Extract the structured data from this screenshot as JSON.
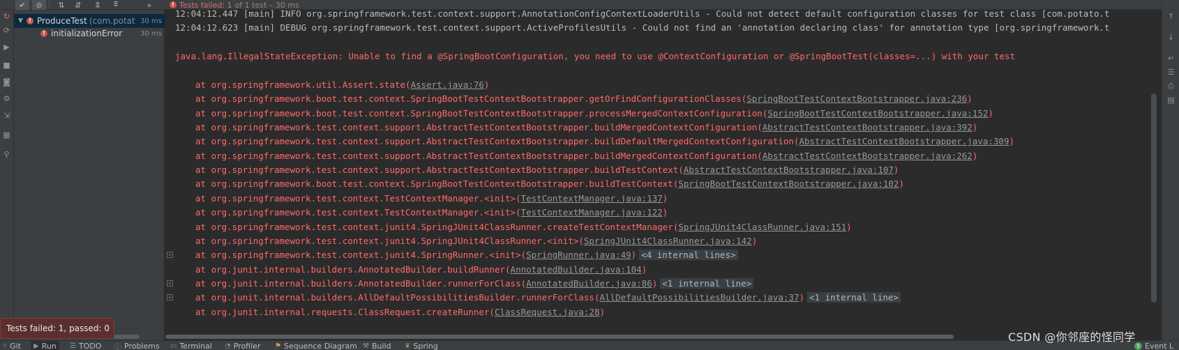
{
  "toolbar": {
    "show_passed_icon": "check-icon",
    "show_ignored_icon": "no-entry-icon",
    "sort_alpha_icon": "sort-alpha-icon",
    "sort_duration_icon": "sort-duration-icon",
    "expand_all_icon": "expand-all-icon",
    "collapse_all_icon": "collapse-all-icon",
    "more_icon": "double-chevron-icon"
  },
  "status": {
    "failed_text": "Tests failed: 1",
    "detail_text": "of 1 test – 30 ms"
  },
  "tree": {
    "root": {
      "name": "ProduceTest",
      "package": "(com.potat",
      "time": "30 ms"
    },
    "child": {
      "name": "initializationError",
      "time": "30 ms"
    }
  },
  "console": {
    "info_lines": [
      "12:04:12.447 [main] INFO org.springframework.test.context.support.AnnotationConfigContextLoaderUtils - Could not detect default configuration classes for test class [com.potato.t",
      "12:04:12.623 [main] DEBUG org.springframework.test.context.support.ActiveProfilesUtils - Could not find an 'annotation declaring class' for annotation type [org.springframework.t"
    ],
    "exception": "java.lang.IllegalStateException: Unable to find a @SpringBootConfiguration, you need to use @ContextConfiguration or @SpringBootTest(classes=...) with your test",
    "trace": [
      {
        "text": "at org.springframework.util.Assert.state(",
        "link": "Assert.java:76",
        "close": ")",
        "fold": ""
      },
      {
        "text": "at org.springframework.boot.test.context.SpringBootTestContextBootstrapper.getOrFindConfigurationClasses(",
        "link": "SpringBootTestContextBootstrapper.java:236",
        "close": ")",
        "fold": ""
      },
      {
        "text": "at org.springframework.boot.test.context.SpringBootTestContextBootstrapper.processMergedContextConfiguration(",
        "link": "SpringBootTestContextBootstrapper.java:152",
        "close": ")",
        "fold": ""
      },
      {
        "text": "at org.springframework.test.context.support.AbstractTestContextBootstrapper.buildMergedContextConfiguration(",
        "link": "AbstractTestContextBootstrapper.java:392",
        "close": ")",
        "fold": ""
      },
      {
        "text": "at org.springframework.test.context.support.AbstractTestContextBootstrapper.buildDefaultMergedContextConfiguration(",
        "link": "AbstractTestContextBootstrapper.java:309",
        "close": ")",
        "fold": ""
      },
      {
        "text": "at org.springframework.test.context.support.AbstractTestContextBootstrapper.buildMergedContextConfiguration(",
        "link": "AbstractTestContextBootstrapper.java:262",
        "close": ")",
        "fold": ""
      },
      {
        "text": "at org.springframework.test.context.support.AbstractTestContextBootstrapper.buildTestContext(",
        "link": "AbstractTestContextBootstrapper.java:107",
        "close": ")",
        "fold": ""
      },
      {
        "text": "at org.springframework.boot.test.context.SpringBootTestContextBootstrapper.buildTestContext(",
        "link": "SpringBootTestContextBootstrapper.java:102",
        "close": ")",
        "fold": ""
      },
      {
        "text": "at org.springframework.test.context.TestContextManager.<init>(",
        "link": "TestContextManager.java:137",
        "close": ")",
        "fold": ""
      },
      {
        "text": "at org.springframework.test.context.TestContextManager.<init>(",
        "link": "TestContextManager.java:122",
        "close": ")",
        "fold": ""
      },
      {
        "text": "at org.springframework.test.context.junit4.SpringJUnit4ClassRunner.createTestContextManager(",
        "link": "SpringJUnit4ClassRunner.java:151",
        "close": ")",
        "fold": ""
      },
      {
        "text": "at org.springframework.test.context.junit4.SpringJUnit4ClassRunner.<init>(",
        "link": "SpringJUnit4ClassRunner.java:142",
        "close": ")",
        "fold": ""
      },
      {
        "text": "at org.springframework.test.context.junit4.SpringRunner.<init>(",
        "link": "SpringRunner.java:49",
        "close": ")",
        "fold": "<4 internal lines>"
      },
      {
        "text": "at org.junit.internal.builders.AnnotatedBuilder.buildRunner(",
        "link": "AnnotatedBuilder.java:104",
        "close": ")",
        "fold": ""
      },
      {
        "text": "at org.junit.internal.builders.AnnotatedBuilder.runnerForClass(",
        "link": "AnnotatedBuilder.java:86",
        "close": ")",
        "fold": "<1 internal line>"
      },
      {
        "text": "at org.junit.internal.builders.AllDefaultPossibilitiesBuilder.runnerForClass(",
        "link": "AllDefaultPossibilitiesBuilder.java:37",
        "close": ")",
        "fold": "<1 internal line>"
      },
      {
        "text": "at org.junit.internal.requests.ClassRequest.createRunner(",
        "link": "ClassRequest.java:28",
        "close": ")",
        "fold": ""
      }
    ]
  },
  "bottom_tabs": [
    {
      "label": "Git",
      "icon": "git-branch-icon"
    },
    {
      "label": "Run",
      "icon": "play-icon"
    },
    {
      "label": "TODO",
      "icon": "list-icon"
    },
    {
      "label": "Problems",
      "icon": "info-icon"
    },
    {
      "label": "Terminal",
      "icon": "terminal-icon"
    },
    {
      "label": "Profiler",
      "icon": "profiler-icon"
    },
    {
      "label": "Sequence Diagram",
      "icon": "sequence-icon"
    },
    {
      "label": "Build",
      "icon": "hammer-icon"
    },
    {
      "label": "Spring",
      "icon": "spring-leaf-icon"
    }
  ],
  "event_log": {
    "count": "5",
    "label": "Event L"
  },
  "tooltip": {
    "text": "Tests failed: 1, passed: 0"
  },
  "watermark": {
    "text": "CSDN @你邻座的怪同学"
  },
  "colors": {
    "error": "#ff6b68",
    "link": "#999999",
    "background": "#2b2b2b",
    "panel": "#3c3f41",
    "selection": "#0d293e"
  }
}
